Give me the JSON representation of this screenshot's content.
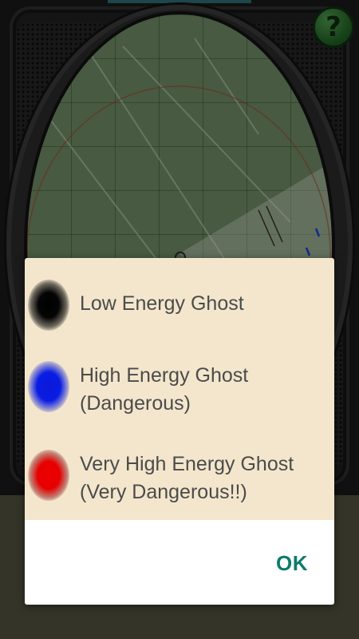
{
  "background": {
    "icons": {
      "help": "question-mark-icon"
    },
    "help_button_label": "?"
  },
  "dialog": {
    "legend": [
      {
        "icon": "black-dot-icon",
        "color": "#000000",
        "label": "Low Energy Ghost"
      },
      {
        "icon": "blue-dot-icon",
        "color": "#0000ff",
        "label": "High Energy Ghost\n(Dangerous)"
      },
      {
        "icon": "red-dot-icon",
        "color": "#ff0000",
        "label": "Very High Energy Ghost\n(Very Dangerous!!)"
      }
    ],
    "ok_label": "OK",
    "colors": {
      "content_background": "#f3e6cc",
      "footer_background": "#ffffff",
      "accent": "#0f7a6d"
    }
  }
}
